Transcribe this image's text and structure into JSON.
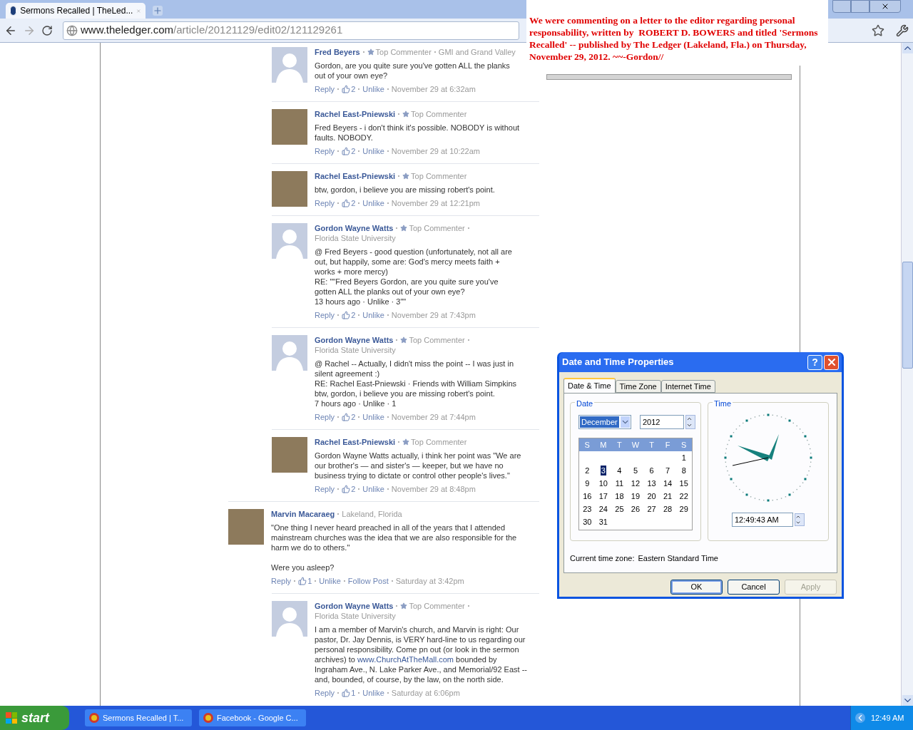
{
  "browser": {
    "tab_title": "Sermons Recalled | TheLed...",
    "url_host": "www.theledger.com",
    "url_path": "/article/20121129/edit02/121129261"
  },
  "note": {
    "text": "We were commenting on a letter to the editor regarding personal responsability, written by  ROBERT D. BOWERS and titled 'Sermons Recalled' -- published by The Ledger (Lakeland, Fla.) on Thursday, November 29, 2012. ~~-Gordon//"
  },
  "thread": [
    {
      "name": "Fred Beyers",
      "badge": "Top Commenter",
      "affiliation": "GMI and Grand Valley",
      "kind": "silhouette",
      "body": [
        [
          "Gordon, are you quite sure you've gotten ALL the planks out of your own eye?"
        ]
      ],
      "actions": {
        "reply": "Reply",
        "likes": "2",
        "unlike": "Unlike",
        "time": "November 29 at 6:32am"
      }
    },
    {
      "name": "Rachel East-Pniewski",
      "badge": "Top Commenter",
      "kind": "photo",
      "body": [
        [
          "Fred Beyers - i don't think it's possible. NOBODY is without faults. NOBODY."
        ]
      ],
      "actions": {
        "reply": "Reply",
        "likes": "2",
        "unlike": "Unlike",
        "time": "November 29 at 10:22am"
      }
    },
    {
      "name": "Rachel East-Pniewski",
      "badge": "Top Commenter",
      "kind": "photo",
      "body": [
        [
          "btw, gordon, i believe you are missing robert's point."
        ]
      ],
      "actions": {
        "reply": "Reply",
        "likes": "2",
        "unlike": "Unlike",
        "time": "November 29 at 12:21pm"
      }
    },
    {
      "name": "Gordon Wayne Watts",
      "badge": "Top Commenter",
      "affiliation": "Florida State University",
      "kind": "silhouette",
      "body": [
        [
          "@ Fred Beyers - good question (unfortunately, not all are out, but happily, some are: God's mercy meets faith + works + more mercy)",
          "RE: \"\"Fred Beyers Gordon, are you quite sure you've gotten ALL the planks out of your own eye?",
          "13 hours ago · Unlike · 3\"\""
        ]
      ],
      "actions": {
        "reply": "Reply",
        "likes": "2",
        "unlike": "Unlike",
        "time": "November 29 at 7:43pm"
      }
    },
    {
      "name": "Gordon Wayne Watts",
      "badge": "Top Commenter",
      "affiliation": "Florida State University",
      "kind": "silhouette",
      "body": [
        [
          "@ Rachel -- Actually, I didn't miss the point -- I was just in silent agreement :)",
          "RE: Rachel East-Pniewski · Friends with William Simpkins",
          "btw, gordon, i believe you are missing robert's point.",
          "7 hours ago · Unlike · 1"
        ]
      ],
      "actions": {
        "reply": "Reply",
        "likes": "2",
        "unlike": "Unlike",
        "time": "November 29 at 7:44pm"
      }
    },
    {
      "name": "Rachel East-Pniewski",
      "badge": "Top Commenter",
      "kind": "photo",
      "body": [
        [
          "Gordon Wayne Watts actually, i think her point was \"We are our brother's — and sister's — keeper, but we have no business trying to dictate or control other people's lives.\""
        ]
      ],
      "actions": {
        "reply": "Reply",
        "likes": "2",
        "unlike": "Unlike",
        "time": "November 29 at 8:48pm"
      }
    }
  ],
  "comments": [
    {
      "name": "Marvin Macaraeg",
      "affiliation": "Lakeland, Florida",
      "kind": "photo",
      "body": [
        [
          "\"One thing I never heard preached in all of the years that I attended mainstream churches was the idea that we are also responsible for the harm we do to others.\""
        ],
        [
          "Were you asleep?"
        ]
      ],
      "actions": {
        "reply": "Reply",
        "likes": "1",
        "unlike": "Unlike",
        "follow": "Follow Post",
        "time": "Saturday at 3:42pm"
      },
      "children": [
        {
          "name": "Gordon Wayne Watts",
          "badge": "Top Commenter",
          "affiliation": "Florida State University",
          "kind": "silhouette",
          "body": [
            [
              [
                {
                  "text": "I am a member of Marvin's church, and Marvin is right: Our pastor, Dr. Jay Dennis, is VERY hard-line to us regarding our personal responsibility. Come pn out (or look in the sermon archives) to ",
                  "kind": "text"
                },
                {
                  "text": "www.ChurchAtTheMall.com",
                  "kind": "link"
                },
                {
                  "text": " bounded by Ingraham Ave., N. Lake Parker Ave., and Memorial/92 East --and, bounded, of course, by the law, on the north side.",
                  "kind": "text"
                }
              ]
            ]
          ],
          "actions": {
            "reply": "Reply",
            "likes": "1",
            "unlike": "Unlike",
            "time": "Saturday at 6:06pm"
          }
        }
      ]
    }
  ],
  "dialog": {
    "title": "Date and Time Properties",
    "help": "?",
    "tabs": [
      {
        "label": "Date & Time",
        "selected": true
      },
      {
        "label": "Time Zone",
        "selected": false
      },
      {
        "label": "Internet Time",
        "selected": false
      }
    ],
    "date_group": "Date",
    "month": "December",
    "year": "2012",
    "weekdays": [
      "S",
      "M",
      "T",
      "W",
      "T",
      "F",
      "S"
    ],
    "weeks": [
      [
        {
          "label": "1",
          "selected": false
        }
      ],
      [
        {
          "label": "2",
          "selected": false
        },
        {
          "label": "3",
          "selected": true
        },
        {
          "label": "4",
          "selected": false
        },
        {
          "label": "5",
          "selected": false
        },
        {
          "label": "6",
          "selected": false
        },
        {
          "label": "7",
          "selected": false
        },
        {
          "label": "8",
          "selected": false
        }
      ],
      [
        {
          "label": "9",
          "selected": false
        },
        {
          "label": "10",
          "selected": false
        },
        {
          "label": "11",
          "selected": false
        },
        {
          "label": "12",
          "selected": false
        },
        {
          "label": "13",
          "selected": false
        },
        {
          "label": "14",
          "selected": false
        },
        {
          "label": "15",
          "selected": false
        }
      ],
      [
        {
          "label": "16",
          "selected": false
        },
        {
          "label": "17",
          "selected": false
        },
        {
          "label": "18",
          "selected": false
        },
        {
          "label": "19",
          "selected": false
        },
        {
          "label": "20",
          "selected": false
        },
        {
          "label": "21",
          "selected": false
        },
        {
          "label": "22",
          "selected": false
        }
      ],
      [
        {
          "label": "23",
          "selected": false
        },
        {
          "label": "24",
          "selected": false
        },
        {
          "label": "25",
          "selected": false
        },
        {
          "label": "26",
          "selected": false
        },
        {
          "label": "27",
          "selected": false
        },
        {
          "label": "28",
          "selected": false
        },
        {
          "label": "29",
          "selected": false
        }
      ],
      [
        {
          "label": "30",
          "selected": false
        },
        {
          "label": "31",
          "selected": false
        }
      ]
    ],
    "time_group": "Time",
    "time": "12:49:43 AM",
    "timezone_label": "Current time zone:",
    "timezone": "Eastern Standard Time",
    "buttons": [
      {
        "label": "OK",
        "default": true,
        "disabled": false
      },
      {
        "label": "Cancel",
        "default": false,
        "disabled": false
      },
      {
        "label": "Apply",
        "default": false,
        "disabled": true
      }
    ]
  },
  "taskbar": {
    "start": "start",
    "tasks": [
      {
        "label": "Sermons Recalled | T...",
        "selected": false
      },
      {
        "label": "Facebook - Google C...",
        "selected": false
      }
    ],
    "clock": "12:49 AM"
  }
}
